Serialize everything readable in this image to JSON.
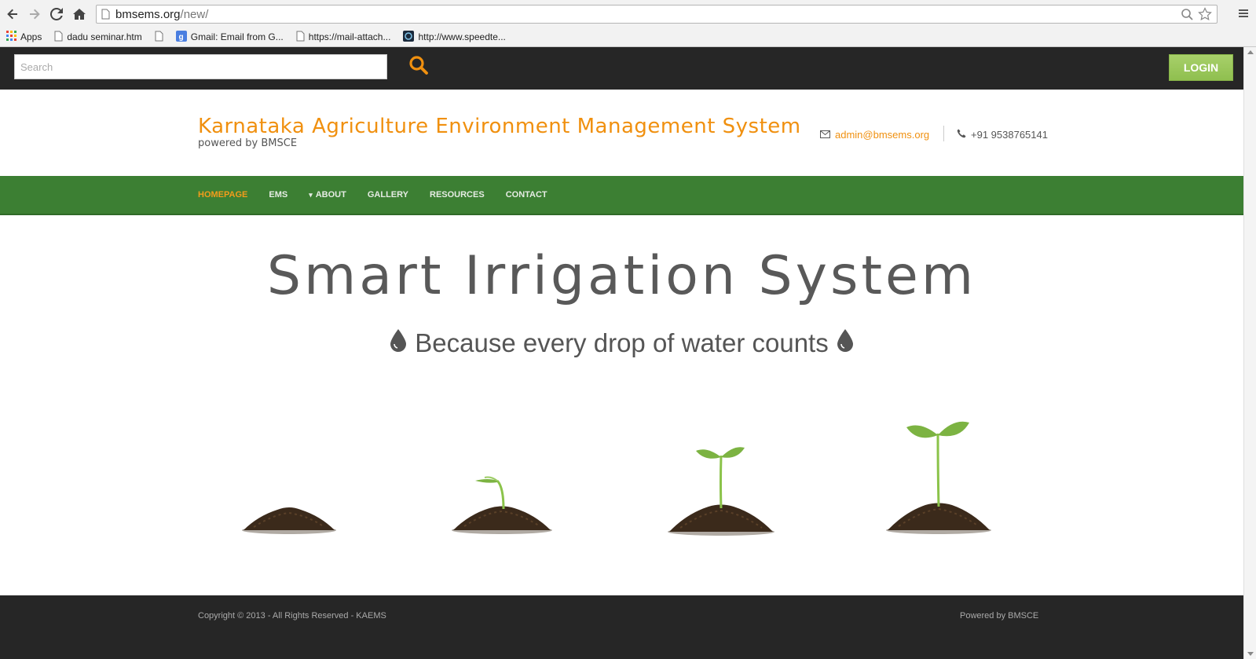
{
  "browser": {
    "url_host": "bmsems.org",
    "url_path": "/new/",
    "bookmarks": [
      {
        "label": "Apps",
        "icon": "apps-grid-icon"
      },
      {
        "label": "dadu seminar.htm",
        "icon": "page-icon"
      },
      {
        "label": "",
        "icon": "page-icon"
      },
      {
        "label": "Gmail: Email from G...",
        "icon": "google-icon"
      },
      {
        "label": "https://mail-attach...",
        "icon": "page-icon"
      },
      {
        "label": "http://www.speedte...",
        "icon": "speedtest-icon"
      }
    ]
  },
  "topbar": {
    "search_placeholder": "Search",
    "login_label": "LOGIN"
  },
  "header": {
    "title": "Karnataka Agriculture Environment Management System",
    "subtitle": "powered by BMSCE",
    "email": "admin@bmsems.org",
    "phone": "+91 9538765141"
  },
  "nav": {
    "items": [
      {
        "label": "HOMEPAGE",
        "active": true
      },
      {
        "label": "EMS",
        "active": false
      },
      {
        "label": "ABOUT",
        "active": false,
        "dropdown": true
      },
      {
        "label": "GALLERY",
        "active": false
      },
      {
        "label": "RESOURCES",
        "active": false
      },
      {
        "label": "CONTACT",
        "active": false
      }
    ]
  },
  "hero": {
    "title": "Smart Irrigation System",
    "tagline": "Because every drop of water counts"
  },
  "footer": {
    "copyright": "Copyright © 2013 - All Rights Reserved - KAEMS",
    "powered": "Powered by BMSCE"
  },
  "colors": {
    "accent": "#f0900f",
    "nav_green": "#3c7f33",
    "login_green": "#9ac85c",
    "dark_bar": "#262626"
  }
}
